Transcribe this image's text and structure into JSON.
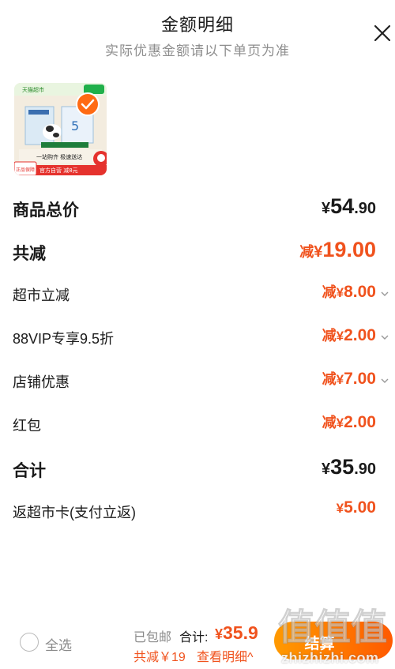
{
  "header": {
    "title": "金额明细",
    "subtitle": "实际优惠金额请以下单页为准"
  },
  "product": {
    "image_badges": [
      "天猫超市",
      "官方自营 减8元",
      "一站购齐 极速送达",
      "正品保障"
    ]
  },
  "rows": {
    "subtotal": {
      "label": "商品总价",
      "currency": "¥",
      "int": "54",
      "dec": ".90"
    },
    "total_discount": {
      "label": "共减",
      "prefix": "减",
      "currency": "¥",
      "int": "19",
      "dec": ".00"
    },
    "supermarket": {
      "label": "超市立减",
      "prefix": "减",
      "currency": "¥",
      "int": "8",
      "dec": ".00"
    },
    "vip": {
      "label": "88VIP专享9.5折",
      "prefix": "减",
      "currency": "¥",
      "int": "2",
      "dec": ".00"
    },
    "store": {
      "label": "店铺优惠",
      "prefix": "减",
      "currency": "¥",
      "int": "7",
      "dec": ".00"
    },
    "redpacket": {
      "label": "红包",
      "prefix": "减",
      "currency": "¥",
      "int": "2",
      "dec": ".00"
    },
    "total": {
      "label": "合计",
      "currency": "¥",
      "int": "35",
      "dec": ".90"
    },
    "cashback": {
      "label": "返超市卡(支付立返)",
      "currency": "¥",
      "int": "5",
      "dec": ".00"
    }
  },
  "footer": {
    "select_all": "全选",
    "shipping": "已包邮",
    "total_label": "合计:",
    "total_currency": "¥",
    "total_value": "35.9",
    "saved": "共减￥19",
    "detail_link": "查看明细^",
    "checkout": "结算"
  },
  "watermark": {
    "text": "值值值",
    "url": "zhizhizhi.com"
  },
  "colors": {
    "accent": "#f0521d",
    "checkout_start": "#ff9a00",
    "checkout_end": "#ff5a00"
  }
}
